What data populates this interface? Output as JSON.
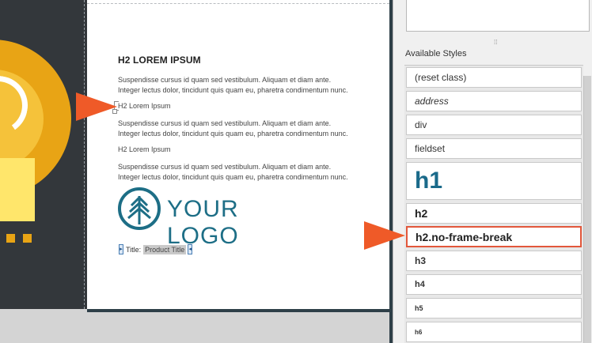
{
  "document": {
    "heading": "H2 LOREM IPSUM",
    "paragraph1_line1": "Suspendisse cursus id quam sed vestibulum. Aliquam et diam ante.",
    "paragraph1_line2": "Integer lectus dolor, tincidunt quis quam eu, pharetra condimentum nunc.",
    "subheading1": "H2 Lorem Ipsum",
    "paragraph2_line1": "Suspendisse cursus id quam sed vestibulum. Aliquam et diam ante.",
    "paragraph2_line2": "Integer lectus dolor, tincidunt quis quam eu, pharetra condimentum nunc.",
    "subheading2": "H2 Lorem Ipsum",
    "paragraph3_line1": "Suspendisse cursus id quam sed vestibulum. Aliquam et diam ante.",
    "paragraph3_line2": "Integer lectus dolor, tincidunt quis quam eu, pharetra condimentum nunc.",
    "logo_text": "YOUR LOGO",
    "title_label": "Title:",
    "title_variable": "Product Title"
  },
  "styles_panel": {
    "label": "Available Styles",
    "items": [
      {
        "label": "(reset class)",
        "style": "normal"
      },
      {
        "label": "address",
        "style": "italic"
      },
      {
        "label": "div",
        "style": "normal"
      },
      {
        "label": "fieldset",
        "style": "normal"
      },
      {
        "label": "h1",
        "style": "h1"
      },
      {
        "label": "h2",
        "style": "h2"
      },
      {
        "label": "h2.no-frame-break",
        "style": "h2-selected"
      },
      {
        "label": "h3",
        "style": "h3"
      },
      {
        "label": "h4",
        "style": "h4"
      },
      {
        "label": "h5",
        "style": "h5"
      },
      {
        "label": "h6",
        "style": "h6"
      }
    ]
  },
  "colors": {
    "accent_arrow": "#ef5a28",
    "selection_border": "#e2573b",
    "logo": "#1d6e86",
    "h1_style": "#1a6a8a"
  }
}
